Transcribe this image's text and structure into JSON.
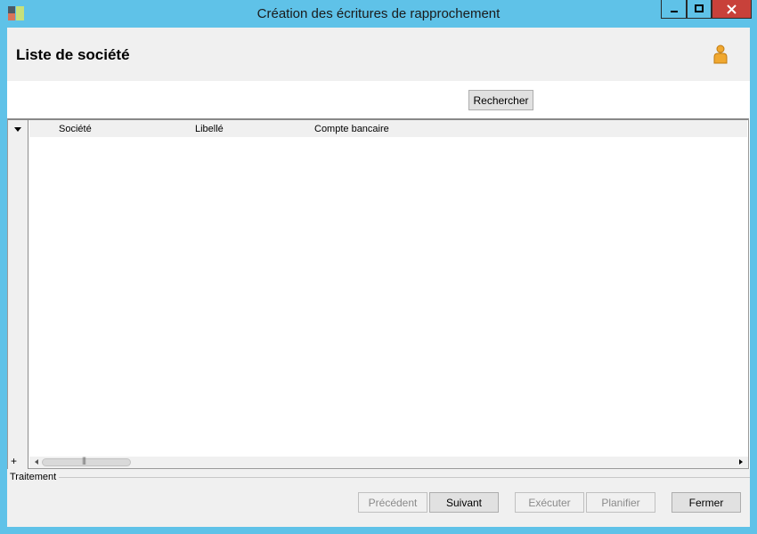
{
  "window": {
    "title": "Création des écritures de rapprochement",
    "buttons": {
      "minimize": "minimize-icon",
      "maximize": "maximize-icon",
      "close": "close-icon"
    }
  },
  "header": {
    "title": "Liste de société",
    "icon": "user-icon"
  },
  "search": {
    "button_label": "Rechercher"
  },
  "grid": {
    "columns": [
      "Société",
      "Libellé",
      "Compte bancaire"
    ],
    "rows": []
  },
  "footer": {
    "group_label": "Traitement",
    "buttons": {
      "previous": "Précédent",
      "next": "Suivant",
      "execute": "Exécuter",
      "schedule": "Planifier",
      "close": "Fermer"
    }
  },
  "colors": {
    "titlebar": "#5fc2e8",
    "close_button": "#c8413a",
    "panel": "#f0f0f0"
  }
}
